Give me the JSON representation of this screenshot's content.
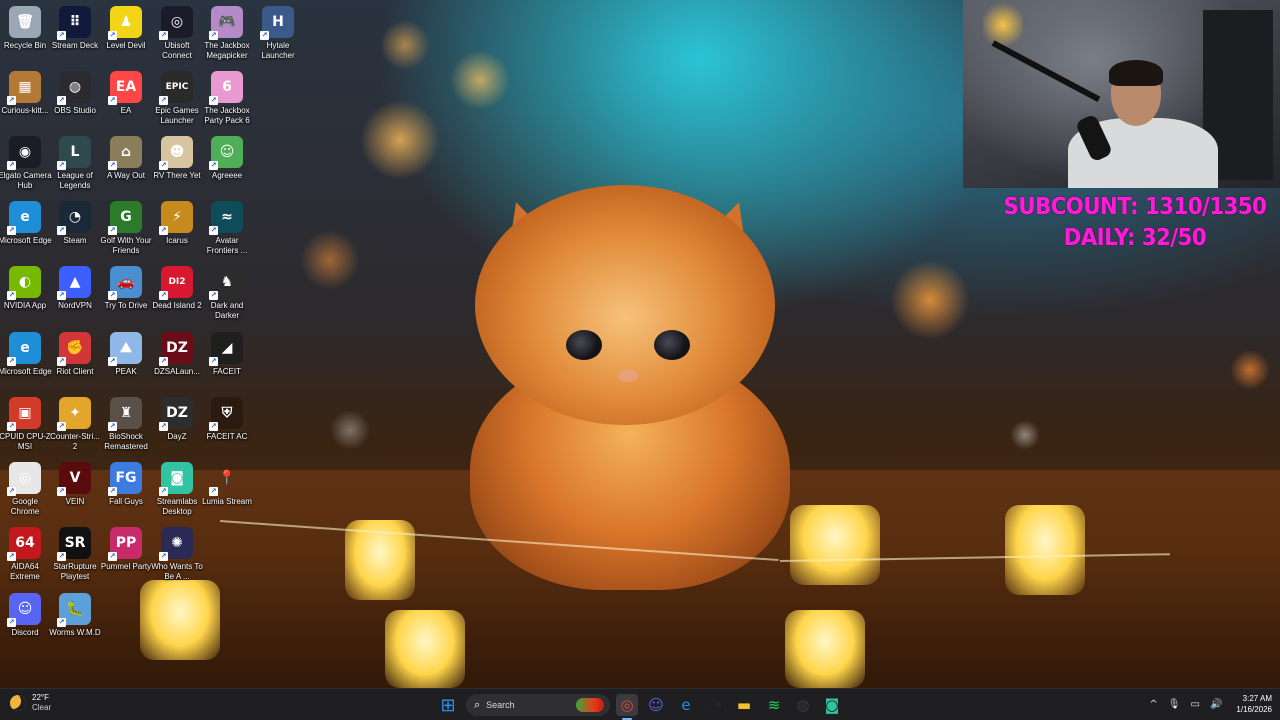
{
  "desktop": {
    "icons": [
      {
        "label": "Recycle Bin",
        "icon": "recycle-bin-icon",
        "color": "#9aa7b5",
        "glyph": "🗑"
      },
      {
        "label": "Curious-kitt...",
        "icon": "folder-icon",
        "color": "#b37a36",
        "glyph": "▦"
      },
      {
        "label": "Elgato Camera Hub",
        "icon": "elgato-camera-hub-icon",
        "color": "#1a1d24",
        "glyph": "◉"
      },
      {
        "label": "Microsoft Edge",
        "icon": "microsoft-edge-icon",
        "color": "#1e8fd6",
        "glyph": "e"
      },
      {
        "label": "NVIDIA App",
        "icon": "nvidia-app-icon",
        "color": "#76b900",
        "glyph": "◐"
      },
      {
        "label": "Microsoft Edge",
        "icon": "microsoft-edge-icon",
        "color": "#1e8fd6",
        "glyph": "e"
      },
      {
        "label": "CPUID CPU-Z MSI",
        "icon": "cpu-z-icon",
        "color": "#d23b2a",
        "glyph": "▣"
      },
      {
        "label": "Google Chrome",
        "icon": "google-chrome-icon",
        "color": "#e7e7e7",
        "glyph": "◎"
      },
      {
        "label": "AIDA64 Extreme",
        "icon": "aida64-icon",
        "color": "#c2181e",
        "glyph": "64"
      },
      {
        "label": "Discord",
        "icon": "discord-icon",
        "color": "#5865f2",
        "glyph": "☺"
      },
      {
        "label": "Stream Deck",
        "icon": "stream-deck-icon",
        "color": "#121a3c",
        "glyph": "⠿"
      },
      {
        "label": "OBS Studio",
        "icon": "obs-studio-icon",
        "color": "#2b2b2f",
        "glyph": "◍"
      },
      {
        "label": "League of Legends",
        "icon": "league-of-legends-icon",
        "color": "#2f4a4f",
        "glyph": "L"
      },
      {
        "label": "Steam",
        "icon": "steam-icon",
        "color": "#1b2838",
        "glyph": "◔"
      },
      {
        "label": "NordVPN",
        "icon": "nordvpn-icon",
        "color": "#3e5fff",
        "glyph": "▲"
      },
      {
        "label": "Riot Client",
        "icon": "riot-client-icon",
        "color": "#d13639",
        "glyph": "✊"
      },
      {
        "label": "Counter-Stri... 2",
        "icon": "counter-strike-icon",
        "color": "#e2a72a",
        "glyph": "✦"
      },
      {
        "label": "VEIN",
        "icon": "vein-icon",
        "color": "#5a0b0b",
        "glyph": "V"
      },
      {
        "label": "StarRupture Playtest",
        "icon": "starrupture-icon",
        "color": "#111",
        "glyph": "SR"
      },
      {
        "label": "Worms W.M.D",
        "icon": "worms-wmd-icon",
        "color": "#5d9fd8",
        "glyph": "🐛"
      },
      {
        "label": "Level Devil",
        "icon": "level-devil-icon",
        "color": "#f2d516",
        "glyph": "♟"
      },
      {
        "label": "EA",
        "icon": "ea-icon",
        "color": "#ff4747",
        "glyph": "EA"
      },
      {
        "label": "A Way Out",
        "icon": "a-way-out-icon",
        "color": "#8a7d5a",
        "glyph": "⌂"
      },
      {
        "label": "Golf With Your Friends",
        "icon": "golf-with-your-friends-icon",
        "color": "#2b7b2b",
        "glyph": "G"
      },
      {
        "label": "Try To Drive",
        "icon": "try-to-drive-icon",
        "color": "#4a8ed0",
        "glyph": "🚗"
      },
      {
        "label": "PEAK",
        "icon": "peak-icon",
        "color": "#8fb8e8",
        "glyph": "⛰"
      },
      {
        "label": "BioShock Remastered",
        "icon": "bioshock-icon",
        "color": "#5a5048",
        "glyph": "♜"
      },
      {
        "label": "Fall Guys",
        "icon": "fall-guys-icon",
        "color": "#3e7be0",
        "glyph": "FG"
      },
      {
        "label": "Pummel Party",
        "icon": "pummel-party-icon",
        "color": "#c92a6a",
        "glyph": "PP"
      },
      {
        "label": "Ubisoft Connect",
        "icon": "ubisoft-connect-icon",
        "color": "#1b1b2a",
        "glyph": "◎"
      },
      {
        "label": "Epic Games Launcher",
        "icon": "epic-games-icon",
        "color": "#2a2a2a",
        "glyph": "EPIC"
      },
      {
        "label": "RV There Yet",
        "icon": "rv-there-yet-icon",
        "color": "#d7c4a0",
        "glyph": "☻"
      },
      {
        "label": "Icarus",
        "icon": "icarus-icon",
        "color": "#c78a1c",
        "glyph": "⚡"
      },
      {
        "label": "Dead Island 2",
        "icon": "dead-island-2-icon",
        "color": "#d8182e",
        "glyph": "DI2"
      },
      {
        "label": "DZSALaun...",
        "icon": "dzsa-launcher-icon",
        "color": "#6b0d17",
        "glyph": "DZ"
      },
      {
        "label": "DayZ",
        "icon": "dayz-icon",
        "color": "#2d2d2d",
        "glyph": "DZ"
      },
      {
        "label": "Streamlabs Desktop",
        "icon": "streamlabs-icon",
        "color": "#31c3a2",
        "glyph": "◙"
      },
      {
        "label": "Who Wants To Be A ...",
        "icon": "who-wants-to-be-icon",
        "color": "#2a2a55",
        "glyph": "✺"
      },
      {
        "label": "The Jackbox Megapicker",
        "icon": "jackbox-megapicker-icon",
        "color": "#b48ac8",
        "glyph": "🎮"
      },
      {
        "label": "The Jackbox Party Pack 6",
        "icon": "jackbox-party-pack-6-icon",
        "color": "#e89ad0",
        "glyph": "6"
      },
      {
        "label": "Agreeee",
        "icon": "agreeee-icon",
        "color": "#4fae58",
        "glyph": "☺"
      },
      {
        "label": "Avatar Frontiers ...",
        "icon": "avatar-frontiers-icon",
        "color": "#0f4c5a",
        "glyph": "≈"
      },
      {
        "label": "Dark and Darker",
        "icon": "dark-and-darker-icon",
        "color": "#2c2c2c",
        "glyph": "♞"
      },
      {
        "label": "FACEIT",
        "icon": "faceit-icon",
        "color": "#1f1f1f",
        "glyph": "◢"
      },
      {
        "label": "FACEIT AC",
        "icon": "faceit-ac-icon",
        "color": "#2a1a10",
        "glyph": "⛨"
      },
      {
        "label": "Lumia Stream",
        "icon": "lumia-stream-icon",
        "color": "transparent",
        "glyph": "📍"
      },
      {
        "label": "Hytale Launcher",
        "icon": "hytale-launcher-icon",
        "color": "#3a5a8a",
        "glyph": "H"
      }
    ]
  },
  "overlay": {
    "subcount": "SUBCOUNT: 1310/1350",
    "daily": "DAILY: 32/50",
    "color": "#ff1bd8"
  },
  "taskbar": {
    "weather": {
      "temp": "22°F",
      "condition": "Clear"
    },
    "search_placeholder": "Search",
    "pinned": [
      {
        "icon": "windows-start-icon",
        "glyph": "⊞",
        "color": "#2f8ff0"
      },
      {
        "icon": "google-chrome-icon",
        "glyph": "◎",
        "color": "#e44c3c"
      },
      {
        "icon": "discord-icon",
        "glyph": "☺",
        "color": "#5865f2"
      },
      {
        "icon": "microsoft-edge-icon",
        "glyph": "e",
        "color": "#1e8fd6"
      },
      {
        "icon": "steam-icon",
        "glyph": "◔",
        "color": "#1b2838"
      },
      {
        "icon": "file-explorer-icon",
        "glyph": "▬",
        "color": "#f2c230"
      },
      {
        "icon": "spotify-icon",
        "glyph": "≋",
        "color": "#1ed760"
      },
      {
        "icon": "obs-studio-icon",
        "glyph": "◍",
        "color": "#3a3a3e"
      },
      {
        "icon": "streamlabs-icon",
        "glyph": "◙",
        "color": "#31c3a2"
      }
    ],
    "tray": {
      "chevron": "^",
      "time": "3:27 AM",
      "date": "1/16/2026"
    }
  }
}
